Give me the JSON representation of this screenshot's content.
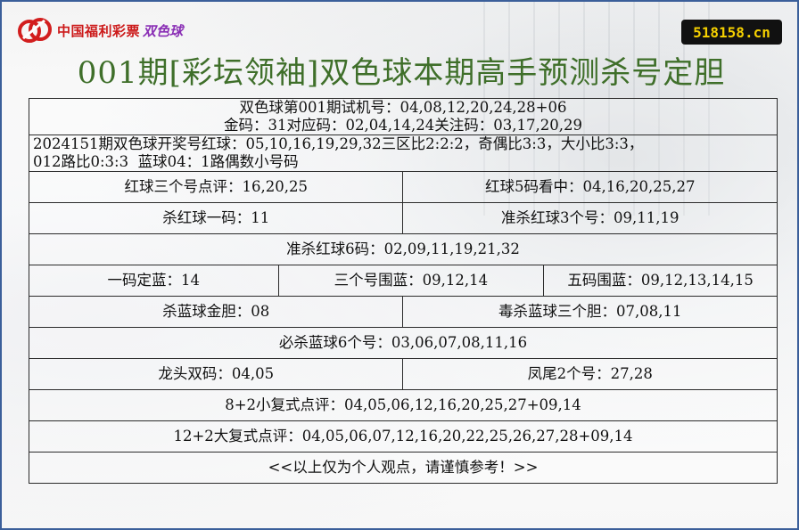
{
  "header": {
    "logo_text": "中国福利彩票",
    "logo_ssq": "双色球",
    "site": "518158.cn",
    "title": "001期[彩坛领袖]双色球本期高手预测杀号定胆"
  },
  "rows": {
    "trial_line": "双色球第001期试机号：04,08,12,20,24,28+06",
    "gold_line": "金码：31对应码：02,04,14,24关注码：03,17,20,29",
    "draw_line1": "2024151期双色球开奖号红球：05,10,16,19,29,32三区比2:2:2，奇偶比3:3，大小比3:3，",
    "draw_line2": "012路比0:3:3  蓝球04：1路偶数小号码",
    "red_three": "红球三个号点评：16,20,25",
    "red_five": "红球5码看中：04,16,20,25,27",
    "kill_red_one": "杀红球一码：11",
    "kill_red_three": "准杀红球3个号：09,11,19",
    "kill_red_six": "准杀红球6码：02,09,11,19,21,32",
    "blue_one": "一码定蓝：14",
    "blue_three": "三个号围蓝：09,12,14",
    "blue_five": "五码围蓝：09,12,13,14,15",
    "kill_blue_gold": "杀蓝球金胆：08",
    "kill_blue_three": "毒杀蓝球三个胆：07,08,11",
    "kill_blue_six": "必杀蓝球6个号：03,06,07,08,11,16",
    "dragon_head": "龙头双码：04,05",
    "phoenix_tail": "凤尾2个号：27,28",
    "small_combo": "8+2小复式点评：04,05,06,12,16,20,25,27+09,14",
    "big_combo": "12+2大复式点评：04,05,06,07,12,16,20,22,25,26,27,28+09,14",
    "disclaimer": "<<以上仅为个人观点，请谨慎参考！>>"
  }
}
